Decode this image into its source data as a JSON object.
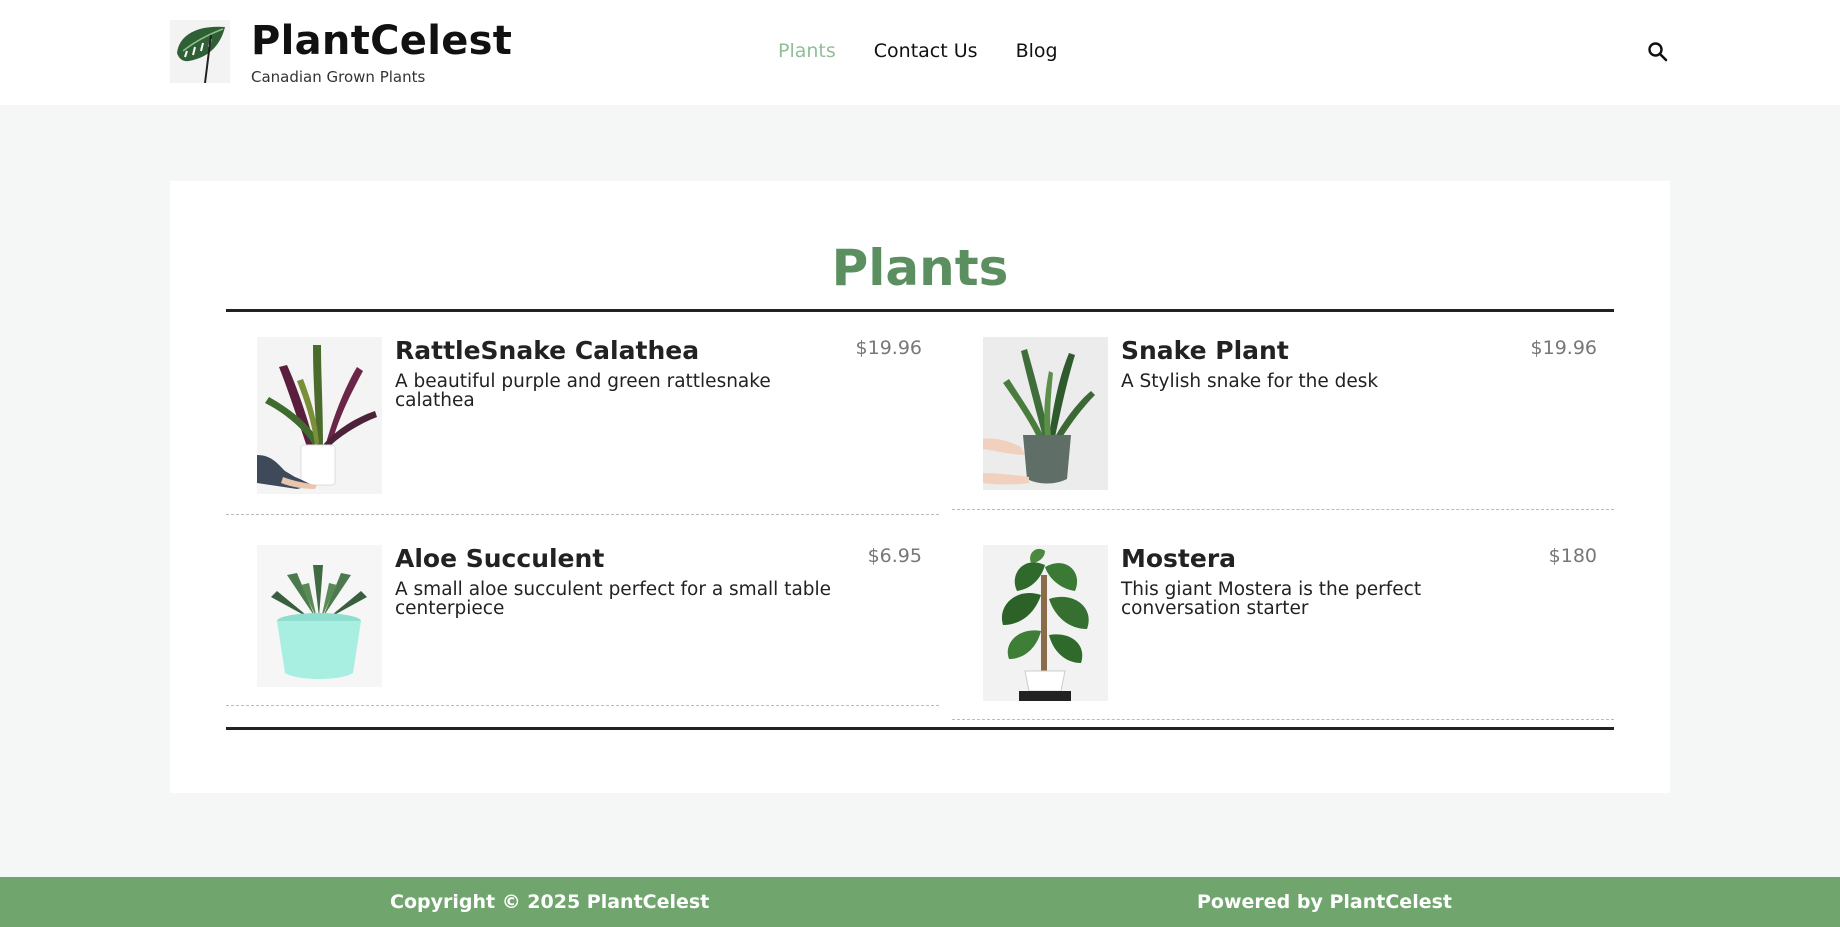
{
  "header": {
    "site_title": "PlantCelest",
    "tagline": "Canadian Grown Plants",
    "nav": [
      {
        "label": "Plants",
        "active": true
      },
      {
        "label": "Contact Us",
        "active": false
      },
      {
        "label": "Blog",
        "active": false
      }
    ],
    "search_icon": "search-icon"
  },
  "main": {
    "title": "Plants",
    "items": [
      {
        "name": "RattleSnake Calathea",
        "price": "$19.96",
        "description": "A beautiful purple and green rattlesnake calathea"
      },
      {
        "name": "Snake Plant",
        "price": "$19.96",
        "description": "A Stylish snake for the desk"
      },
      {
        "name": "Aloe Succulent",
        "price": "$6.95",
        "description": "A small aloe succulent perfect for a small table centerpiece"
      },
      {
        "name": "Mostera",
        "price": "$180",
        "description": "This giant Mostera is the perfect conversation starter"
      }
    ]
  },
  "footer": {
    "copyright": "Copyright © 2025 PlantCelest",
    "powered_by": "Powered by PlantCelest"
  },
  "colors": {
    "accent_green": "#5b8f5f",
    "nav_active": "#8fbf98",
    "footer_bg": "#70a56e",
    "page_bg": "#f5f7f6"
  }
}
